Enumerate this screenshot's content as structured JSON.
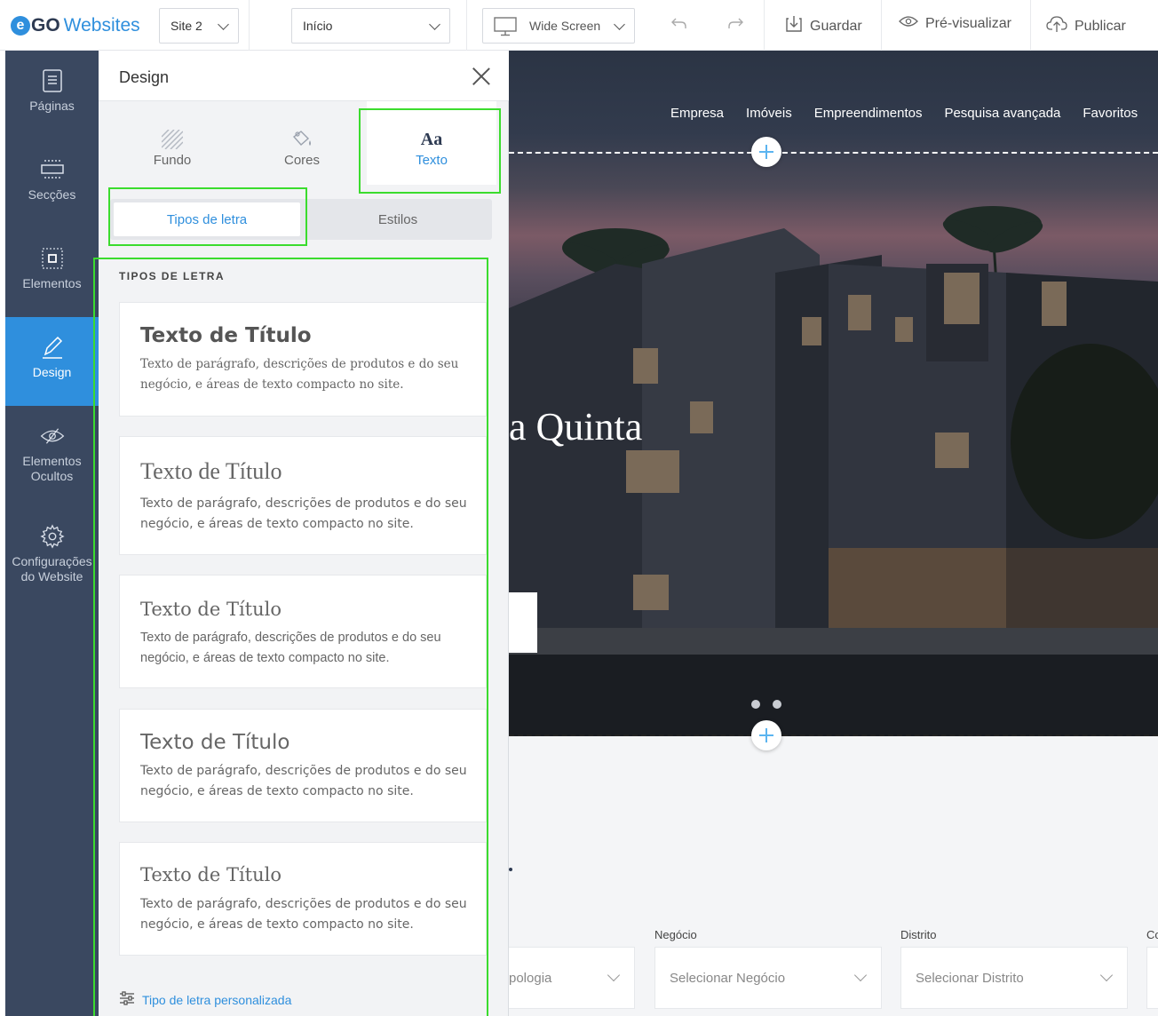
{
  "topbar": {
    "logo_go": "GO",
    "logo_web": "Websites",
    "site_select": "Site 2",
    "page_select": "Início",
    "screen_select": "Wide Screen",
    "save": "Guardar",
    "preview": "Pré-visualizar",
    "publish": "Publicar"
  },
  "leftnav": {
    "items": [
      {
        "label": "Páginas",
        "icon": "pages-icon"
      },
      {
        "label": "Secções",
        "icon": "sections-icon"
      },
      {
        "label": "Elementos",
        "icon": "elements-icon"
      },
      {
        "label": "Design",
        "icon": "pen-icon"
      },
      {
        "label": "Elementos Ocultos",
        "icon": "eye-hidden-icon"
      },
      {
        "label": "Configurações do Website",
        "icon": "gear-icon"
      }
    ],
    "active": "Design"
  },
  "panel": {
    "title": "Design",
    "tabs": [
      {
        "label": "Fundo",
        "icon": "pattern-icon"
      },
      {
        "label": "Cores",
        "icon": "paint-bucket-icon"
      },
      {
        "label": "Texto",
        "icon_text": "Aa"
      }
    ],
    "subtabs": [
      "Tipos de letra",
      "Estilos"
    ],
    "section_label": "TIPOS DE LETRA",
    "cards": [
      {
        "title": "Texto de Título",
        "body": "Texto de parágrafo, descrições de produtos e do seu negócio, e áreas de texto compacto no site."
      },
      {
        "title": "Texto de Título",
        "body": "Texto de parágrafo, descrições de produtos e do seu negócio, e áreas de texto compacto no site."
      },
      {
        "title": "Texto de Título",
        "body": "Texto de parágrafo, descrições de produtos e do seu negócio, e áreas de texto compacto no site."
      },
      {
        "title": "Texto de Título",
        "body": "Texto de parágrafo, descrições de produtos e do seu negócio, e áreas de texto compacto no site."
      },
      {
        "title": "Texto de Título",
        "body": "Texto de parágrafo, descrições de produtos e do seu negócio, e áreas de texto compacto no site."
      }
    ],
    "custom_font_link": "Tipo de letra personalizada"
  },
  "preview": {
    "nav": [
      "Empresa",
      "Imóveis",
      "Empreendimentos",
      "Pesquisa avançada",
      "Favoritos"
    ],
    "hero_title": "a Quinta",
    "search": {
      "labels": [
        "Negócio",
        "Distrito",
        "Co"
      ],
      "selects": [
        "pologia",
        "Selecionar Negócio",
        "Selecionar Distrito"
      ]
    }
  },
  "colors": {
    "accent": "#2f8fdd",
    "nav_bg": "#3a4860",
    "highlight": "#3bdc2e"
  }
}
